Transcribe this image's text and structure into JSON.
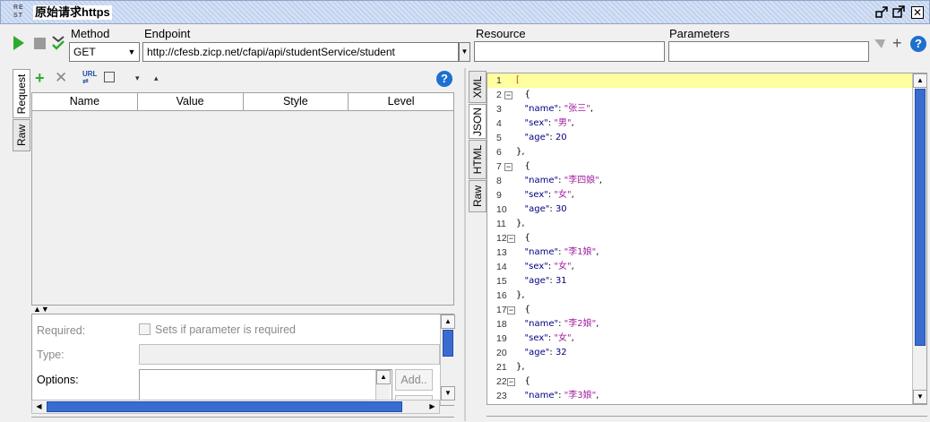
{
  "window": {
    "title": "原始请求https",
    "rest_badge": "RE ST"
  },
  "toolbar": {
    "method_label": "Method",
    "method_value": "GET",
    "endpoint_label": "Endpoint",
    "endpoint_value": "http://cfesb.zicp.net/cfapi/api/studentService/student",
    "resource_label": "Resource",
    "resource_value": "",
    "parameters_label": "Parameters",
    "parameters_value": ""
  },
  "request": {
    "tabs": [
      "Request",
      "Raw"
    ],
    "columns": [
      "Name",
      "Value",
      "Style",
      "Level"
    ],
    "form": {
      "required_label": "Required:",
      "required_checkbox_label": "Sets if parameter is required",
      "type_label": "Type:",
      "options_label": "Options:",
      "add_button": "Add.."
    }
  },
  "response": {
    "tabs": [
      "XML",
      "JSON",
      "HTML",
      "Raw"
    ],
    "lines": [
      {
        "n": "1",
        "text": "[",
        "fold": false
      },
      {
        "n": "2",
        "text": "   {",
        "fold": true
      },
      {
        "n": "3",
        "text": "   \"name\": \"张三\",",
        "fold": false
      },
      {
        "n": "4",
        "text": "   \"sex\": \"男\",",
        "fold": false
      },
      {
        "n": "5",
        "text": "   \"age\": 20",
        "fold": false
      },
      {
        "n": "6",
        "text": "},",
        "fold": false
      },
      {
        "n": "7",
        "text": "   {",
        "fold": true
      },
      {
        "n": "8",
        "text": "   \"name\": \"李四娘\",",
        "fold": false
      },
      {
        "n": "9",
        "text": "   \"sex\": \"女\",",
        "fold": false
      },
      {
        "n": "10",
        "text": "   \"age\": 30",
        "fold": false
      },
      {
        "n": "11",
        "text": "},",
        "fold": false
      },
      {
        "n": "12",
        "text": "   {",
        "fold": true
      },
      {
        "n": "13",
        "text": "   \"name\": \"李1娘\",",
        "fold": false
      },
      {
        "n": "14",
        "text": "   \"sex\": \"女\",",
        "fold": false
      },
      {
        "n": "15",
        "text": "   \"age\": 31",
        "fold": false
      },
      {
        "n": "16",
        "text": "},",
        "fold": false
      },
      {
        "n": "17",
        "text": "   {",
        "fold": true
      },
      {
        "n": "18",
        "text": "   \"name\": \"李2娘\",",
        "fold": false
      },
      {
        "n": "19",
        "text": "   \"sex\": \"女\",",
        "fold": false
      },
      {
        "n": "20",
        "text": "   \"age\": 32",
        "fold": false
      },
      {
        "n": "21",
        "text": "},",
        "fold": false
      },
      {
        "n": "22",
        "text": "   {",
        "fold": true
      },
      {
        "n": "23",
        "text": "   \"name\": \"李3娘\",",
        "fold": false
      }
    ]
  },
  "colors": {
    "highlight_line": "#ffffa0",
    "json_string": "#a020a0",
    "json_key": "#000080",
    "run_icon": "#2eaa2e",
    "help_icon": "#1e6fd0"
  }
}
